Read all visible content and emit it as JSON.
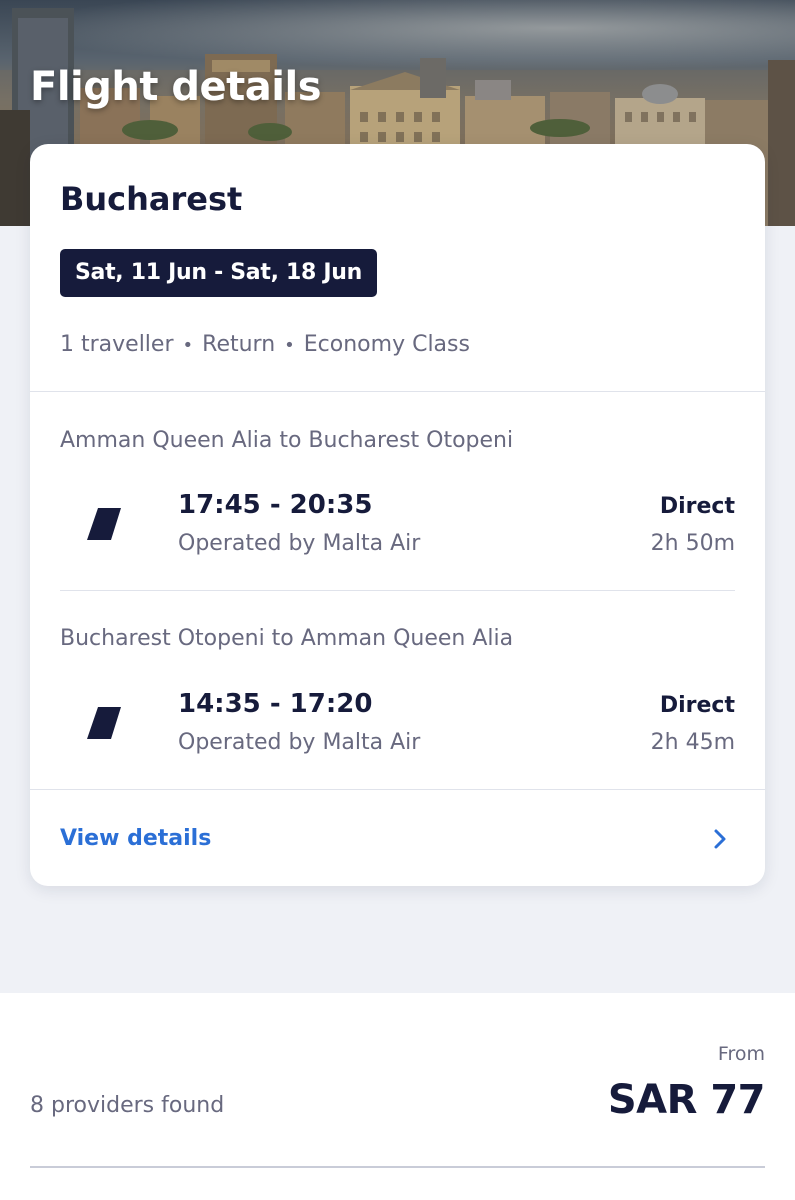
{
  "header": {
    "title": "Flight details"
  },
  "trip": {
    "destination": "Bucharest",
    "dates": "Sat, 11 Jun - Sat, 18 Jun",
    "travellers": "1 traveller",
    "trip_type": "Return",
    "cabin_class": "Economy Class",
    "separator": "•"
  },
  "legs": [
    {
      "route": "Amman Queen Alia to Bucharest Otopeni",
      "times": "17:45 - 20:35",
      "operator": "Operated by Malta Air",
      "stops": "Direct",
      "duration": "2h 50m",
      "airline_icon": "airline-tail-icon"
    },
    {
      "route": "Bucharest Otopeni to Amman Queen Alia",
      "times": "14:35 - 17:20",
      "operator": "Operated by Malta Air",
      "stops": "Direct",
      "duration": "2h 45m",
      "airline_icon": "airline-tail-icon"
    }
  ],
  "card": {
    "view_details_label": "View details",
    "chevron_icon": "chevron-right-icon"
  },
  "pricing": {
    "providers": "8 providers found",
    "from_label": "From",
    "price": "SAR 77"
  },
  "colors": {
    "primary_dark": "#161b3b",
    "link_blue": "#2b6fd6",
    "secondary_text": "#68697f",
    "page_background": "#eff1f6"
  }
}
